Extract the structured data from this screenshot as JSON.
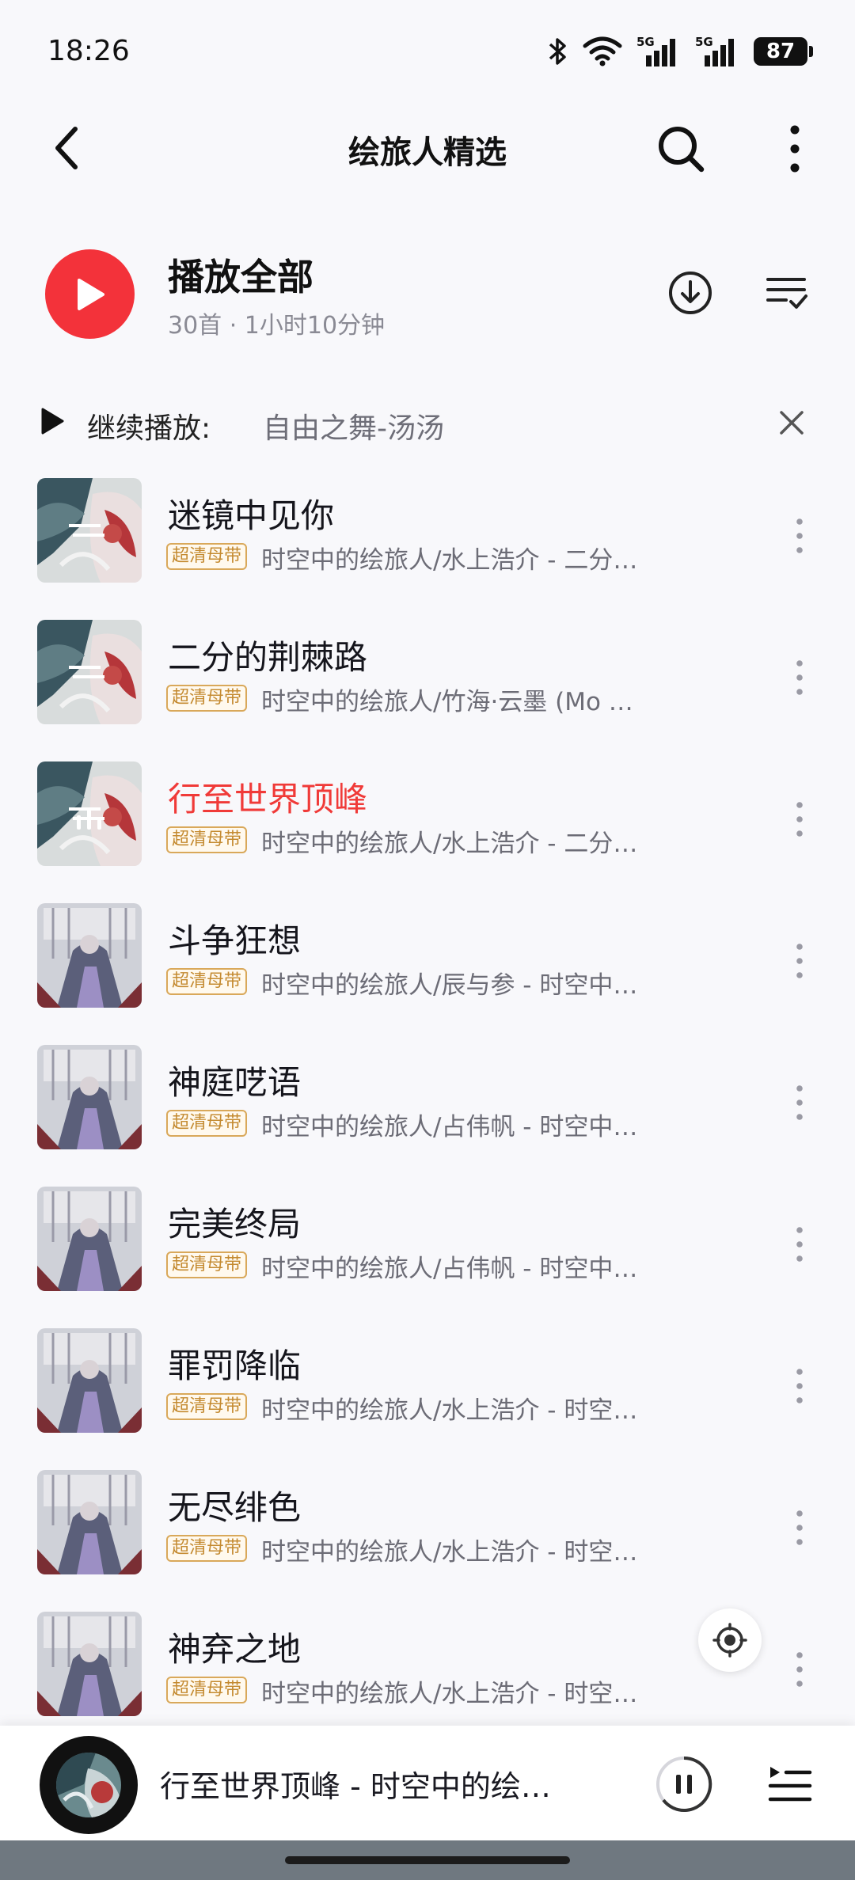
{
  "status_bar": {
    "time": "18:26",
    "battery": "87",
    "icons": [
      "bluetooth-icon",
      "wifi-icon",
      "signal-5g-icon",
      "signal-5g-icon"
    ]
  },
  "header": {
    "title": "绘旅人精选",
    "icons": [
      "back-arrow-icon",
      "search-icon",
      "more-vertical-icon"
    ]
  },
  "play_all": {
    "title": "播放全部",
    "subtitle": "30首 · 1小时10分钟"
  },
  "continue": {
    "label": "继续播放:",
    "track": "自由之舞-汤汤"
  },
  "songs": [
    {
      "title": "迷镜中见你",
      "badge": "超清母带",
      "subtitle": "时空中的绘旅人/水上浩介 - 二分…",
      "playing": false,
      "cover_style": "a"
    },
    {
      "title": "二分的荆棘路",
      "badge": "超清母带",
      "subtitle": "时空中的绘旅人/竹海·云墨 (Mo …",
      "playing": false,
      "cover_style": "a"
    },
    {
      "title": "行至世界顶峰",
      "badge": "超清母带",
      "subtitle": "时空中的绘旅人/水上浩介 - 二分…",
      "playing": true,
      "cover_style": "a"
    },
    {
      "title": "斗争狂想",
      "badge": "超清母带",
      "subtitle": "时空中的绘旅人/辰与参 - 时空中…",
      "playing": false,
      "cover_style": "b"
    },
    {
      "title": "神庭呓语",
      "badge": "超清母带",
      "subtitle": "时空中的绘旅人/占伟帆 - 时空中…",
      "playing": false,
      "cover_style": "b"
    },
    {
      "title": "完美终局",
      "badge": "超清母带",
      "subtitle": "时空中的绘旅人/占伟帆 - 时空中…",
      "playing": false,
      "cover_style": "b"
    },
    {
      "title": "罪罚降临",
      "badge": "超清母带",
      "subtitle": "时空中的绘旅人/水上浩介 - 时空…",
      "playing": false,
      "cover_style": "b"
    },
    {
      "title": "无尽绯色",
      "badge": "超清母带",
      "subtitle": "时空中的绘旅人/水上浩介 - 时空…",
      "playing": false,
      "cover_style": "b"
    },
    {
      "title": "神弃之地",
      "badge": "超清母带",
      "subtitle": "时空中的绘旅人/水上浩介 - 时空…",
      "playing": false,
      "cover_style": "b"
    }
  ],
  "mini_player": {
    "title": "行至世界顶峰 - 时空中的绘…",
    "state": "playing"
  },
  "colors": {
    "accent": "#f3323a",
    "badge": "#d9a85a",
    "background": "#f8f8fb"
  }
}
